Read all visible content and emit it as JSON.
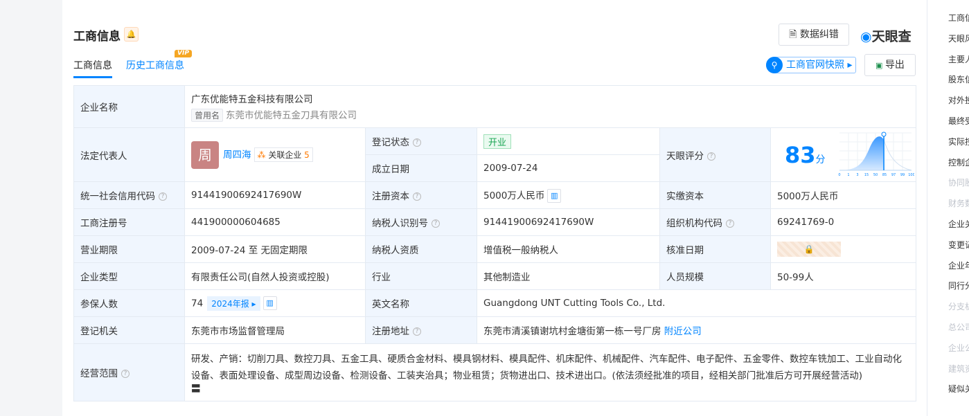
{
  "header": {
    "title": "工商信息",
    "tabs": [
      "工商信息",
      "历史工商信息"
    ],
    "vip": "VIP",
    "feedback": "数据纠错",
    "logo": "天眼查",
    "snapshot": "工商官网快照",
    "export": "导出"
  },
  "sidebar": [
    "工商信",
    "天眼风",
    "主要人",
    "股东信",
    "对外投",
    "最终受",
    "实际控",
    "控制企",
    "协同股",
    "财务数",
    "企业关",
    "变更记",
    "企业年",
    "同行分",
    "分支机",
    "总公司",
    "企业公",
    "建筑资",
    "疑似关"
  ],
  "info": {
    "name_label": "企业名称",
    "name": "广东优能特五金科技有限公司",
    "former_tag": "曾用名",
    "former": "东莞市优能特五金刀具有限公司",
    "legal_label": "法定代表人",
    "legal_avatar": "周",
    "legal": "周四海",
    "related_label": "关联企业",
    "related_count": "5",
    "status_label": "登记状态",
    "status": "开业",
    "est_label": "成立日期",
    "est": "2009-07-24",
    "rating_label": "天眼评分",
    "rating": "83",
    "rating_unit": "分",
    "rating_ticks": [
      "0",
      "1",
      "3",
      "15",
      "50",
      "85",
      "97",
      "99",
      "100"
    ],
    "credit_label": "统一社会信用代码",
    "credit": "91441900692417690W",
    "capital_label": "注册资本",
    "capital": "5000万人民币",
    "paid_label": "实缴资本",
    "paid": "5000万人民币",
    "reg_label": "工商注册号",
    "reg": "441900000604685",
    "tax_label": "纳税人识别号",
    "tax": "91441900692417690W",
    "org_label": "组织机构代码",
    "org": "69241769-0",
    "term_label": "营业期限",
    "term": "2009-07-24 至 无固定期限",
    "taxq_label": "纳税人资质",
    "taxq": "增值税一般纳税人",
    "approve_label": "核准日期",
    "type_label": "企业类型",
    "type": "有限责任公司(自然人投资或控股)",
    "industry_label": "行业",
    "industry": "其他制造业",
    "staff_label": "人员规模",
    "staff": "50-99人",
    "insured_label": "参保人数",
    "insured": "74",
    "report": "2024年报",
    "en_label": "英文名称",
    "en": "Guangdong UNT Cutting Tools Co., Ltd.",
    "authority_label": "登记机关",
    "authority": "东莞市市场监督管理局",
    "addr_label": "注册地址",
    "addr": "东莞市清溪镇谢坑村金塘街第一栋一号厂房",
    "nearby": "附近公司",
    "scope_label": "经营范围",
    "scope": "研发、产销：切削刀具、数控刀具、五金工具、硬质合金材料、模具钢材料、模具配件、机床配件、机械配件、汽车配件、电子配件、五金零件、数控车铣加工、工业自动化设备、表面处理设备、成型周边设备、检测设备、工装夹治具；物业租赁；货物进出口、技术进出口。(依法须经批准的项目，经相关部门批准后方可开展经营活动)"
  },
  "colors": {
    "accent": "#0084ff",
    "label_bg": "#f0f6fe"
  }
}
